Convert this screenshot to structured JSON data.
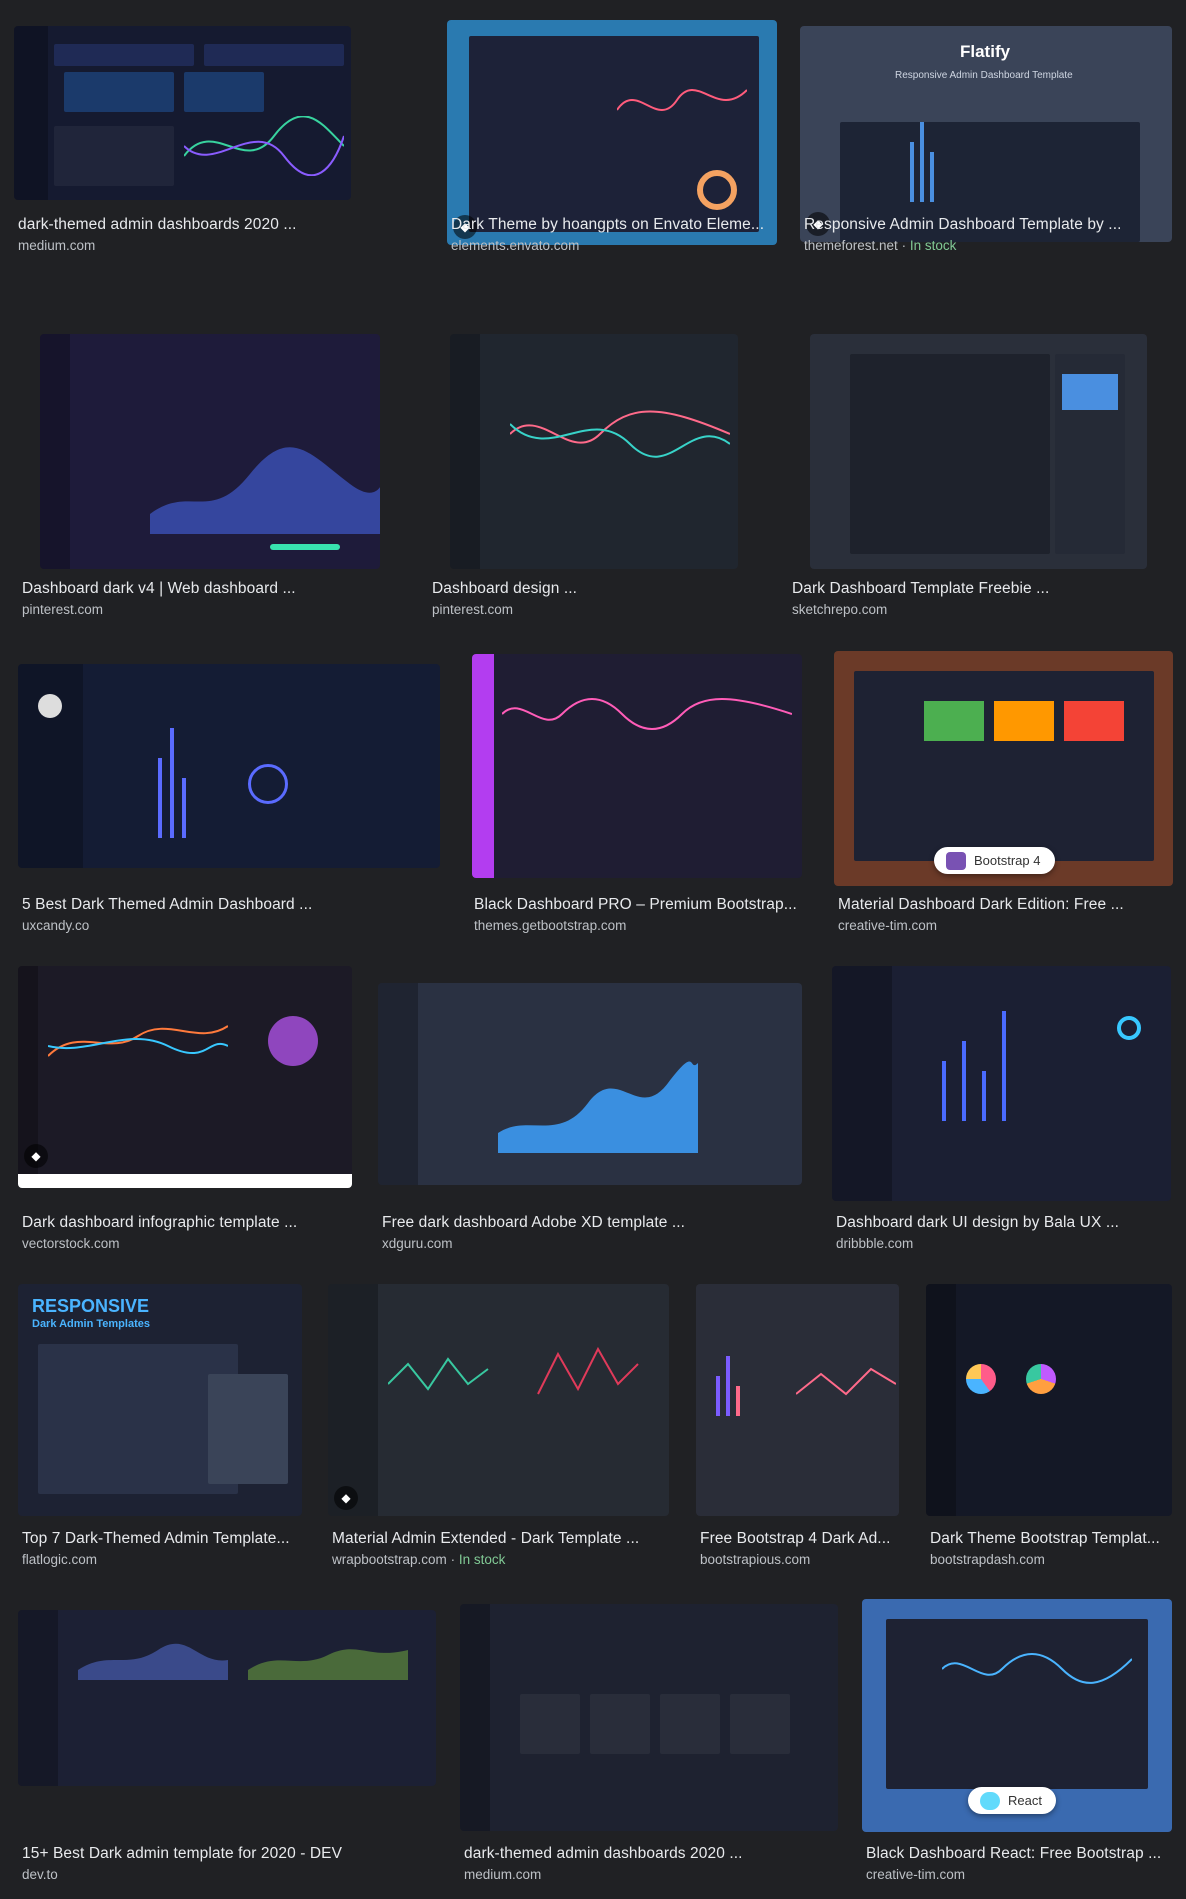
{
  "results": [
    {
      "title": "dark-themed admin dashboards 2020 ...",
      "source": "medium.com",
      "stock": ""
    },
    {
      "title": "Dark Theme by hoangpts on Envato Eleme...",
      "source": "elements.envato.com",
      "stock": ""
    },
    {
      "title": "Responsive Admin Dashboard Template by ...",
      "source": "themeforest.net",
      "stock": "In stock"
    },
    {
      "title": "Dashboard dark v4 | Web dashboard ...",
      "source": "pinterest.com",
      "stock": ""
    },
    {
      "title": "Dashboard design ...",
      "source": "pinterest.com",
      "stock": ""
    },
    {
      "title": "Dark Dashboard Template Freebie ...",
      "source": "sketchrepo.com",
      "stock": ""
    },
    {
      "title": "5 Best Dark Themed Admin Dashboard ...",
      "source": "uxcandy.co",
      "stock": ""
    },
    {
      "title": "Black Dashboard PRO – Premium Bootstrap...",
      "source": "themes.getbootstrap.com",
      "stock": ""
    },
    {
      "title": "Material Dashboard Dark Edition: Free ...",
      "source": "creative-tim.com",
      "stock": ""
    },
    {
      "title": "Dark dashboard infographic template ...",
      "source": "vectorstock.com",
      "stock": ""
    },
    {
      "title": "Free dark dashboard Adobe XD template ...",
      "source": "xdguru.com",
      "stock": ""
    },
    {
      "title": "Dashboard dark UI design by Bala UX ...",
      "source": "dribbble.com",
      "stock": ""
    },
    {
      "title": "Top 7 Dark-Themed Admin Template...",
      "source": "flatlogic.com",
      "stock": ""
    },
    {
      "title": "Material Admin Extended - Dark Template ...",
      "source": "wrapbootstrap.com",
      "stock": "In stock"
    },
    {
      "title": "Free Bootstrap 4 Dark Ad...",
      "source": "bootstrapious.com",
      "stock": ""
    },
    {
      "title": "Dark Theme Bootstrap Templat...",
      "source": "bootstrapdash.com",
      "stock": ""
    },
    {
      "title": "15+ Best Dark admin template for 2020 - DEV",
      "source": "dev.to",
      "stock": ""
    },
    {
      "title": "dark-themed admin dashboards 2020 ...",
      "source": "medium.com",
      "stock": ""
    },
    {
      "title": "Black Dashboard React: Free Bootstrap ...",
      "source": "creative-tim.com",
      "stock": ""
    }
  ],
  "thumb_text": {
    "flatify_title": "Flatify",
    "flatify_sub": "Responsive Admin Dashboard Template",
    "bootstrap4_pill": "Bootstrap 4",
    "responsive_title": "RESPONSIVE",
    "responsive_sub": "Dark Admin Templates",
    "react_pill": "React"
  },
  "stock_separator": " · ",
  "colors": {
    "page_bg": "#202124",
    "title": "#e8eaed",
    "source": "#bdc1c6",
    "stock": "#81c995"
  }
}
